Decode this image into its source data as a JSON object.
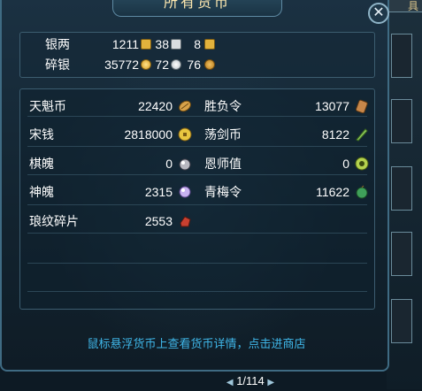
{
  "window": {
    "title": "所有货币",
    "close_icon": "close-icon",
    "side_tab": "具"
  },
  "silver": {
    "row1": {
      "label": "银两",
      "values": [
        "1211",
        "38",
        "8"
      ]
    },
    "row2": {
      "label": "碎银",
      "values": [
        "35772",
        "72",
        "76"
      ]
    }
  },
  "currencies": [
    {
      "name": "天魁币",
      "value": "22420",
      "icon": "tiankui-coin-icon",
      "color": "#d8a24a"
    },
    {
      "name": "胜负令",
      "value": "13077",
      "icon": "shengfu-token-icon",
      "color": "#c7874a"
    },
    {
      "name": "宋钱",
      "value": "2818000",
      "icon": "song-coin-icon",
      "color": "#e8c640"
    },
    {
      "name": "荡剑币",
      "value": "8122",
      "icon": "dangjian-coin-icon",
      "color": "#8cc85a"
    },
    {
      "name": "棋魄",
      "value": "0",
      "icon": "qipo-icon",
      "color": "#b8b8c0"
    },
    {
      "name": "恩师值",
      "value": "0",
      "icon": "enshi-icon",
      "color": "#b4d24e"
    },
    {
      "name": "神魄",
      "value": "2315",
      "icon": "shenpo-icon",
      "color": "#c8b2f0"
    },
    {
      "name": "青梅令",
      "value": "11622",
      "icon": "qingmei-token-icon",
      "color": "#3fa05a"
    },
    {
      "name": "琅纹碎片",
      "value": "2553",
      "icon": "langwen-shard-icon",
      "color": "#c84030"
    }
  ],
  "footer": {
    "hint": "鼠标悬浮货币上查看货币详情，点击进商店"
  },
  "pager": {
    "text": "1/114"
  }
}
